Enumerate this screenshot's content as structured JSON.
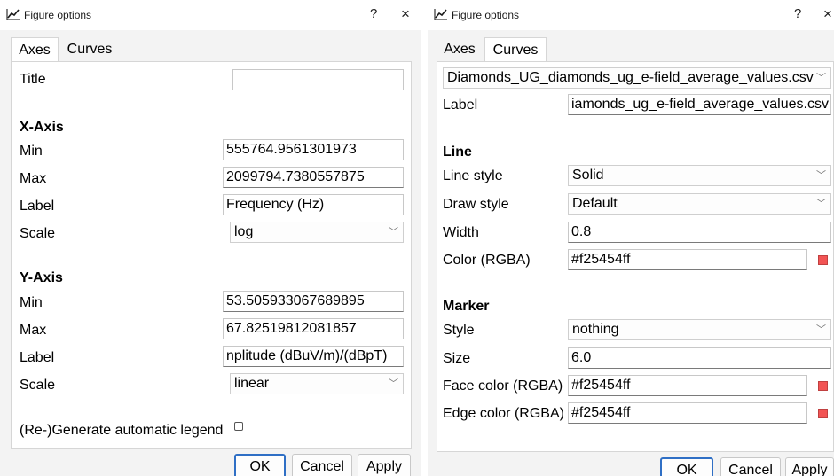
{
  "dialog_a": {
    "title": "Figure options",
    "help": "?",
    "close": "×",
    "tabs": [
      "Axes",
      "Curves"
    ],
    "title_label": "Title",
    "title_value": "",
    "xaxis": {
      "header": "X-Axis",
      "min_label": "Min",
      "min_value": "555764.9561301973",
      "max_label": "Max",
      "max_value": "2099794.7380557875",
      "label_label": "Label",
      "label_value": "Frequency (Hz)",
      "scale_label": "Scale",
      "scale_value": "log"
    },
    "yaxis": {
      "header": "Y-Axis",
      "min_label": "Min",
      "min_value": "53.505933067689895",
      "max_label": "Max",
      "max_value": "67.82519812081857",
      "label_label": "Label",
      "label_value": "nplitude (dBuV/m)/(dBpT)",
      "scale_label": "Scale",
      "scale_value": "linear"
    },
    "legend_label": "(Re-)Generate automatic legend",
    "legend_checked": false,
    "buttons": {
      "ok": "OK",
      "cancel": "Cancel",
      "apply": "Apply"
    }
  },
  "dialog_b": {
    "title": "Figure options",
    "help": "?",
    "close": "×",
    "tabs": [
      "Axes",
      "Curves"
    ],
    "curve_select": "Diamonds_UG_diamonds_ug_e-field_average_values.csv",
    "label_label": "Label",
    "label_value": "iamonds_ug_e-field_average_values.csv",
    "line": {
      "header": "Line",
      "style_label": "Line style",
      "style_value": "Solid",
      "draw_label": "Draw style",
      "draw_value": "Default",
      "width_label": "Width",
      "width_value": "0.8",
      "color_label": "Color (RGBA)",
      "color_value": "#f25454ff"
    },
    "marker": {
      "header": "Marker",
      "style_label": "Style",
      "style_value": "nothing",
      "size_label": "Size",
      "size_value": "6.0",
      "face_label": "Face color (RGBA)",
      "face_value": "#f25454ff",
      "edge_label": "Edge color (RGBA)",
      "edge_value": "#f25454ff"
    },
    "buttons": {
      "ok": "OK",
      "cancel": "Cancel",
      "apply": "Apply"
    }
  },
  "colors": {
    "curve_color": "#f25454",
    "default_button_border": "#2f6fc5"
  },
  "icons": {
    "window_icon": "chart-line-icon",
    "dropdown": "chevron-down-icon",
    "swatch": "color-swatch-icon"
  }
}
